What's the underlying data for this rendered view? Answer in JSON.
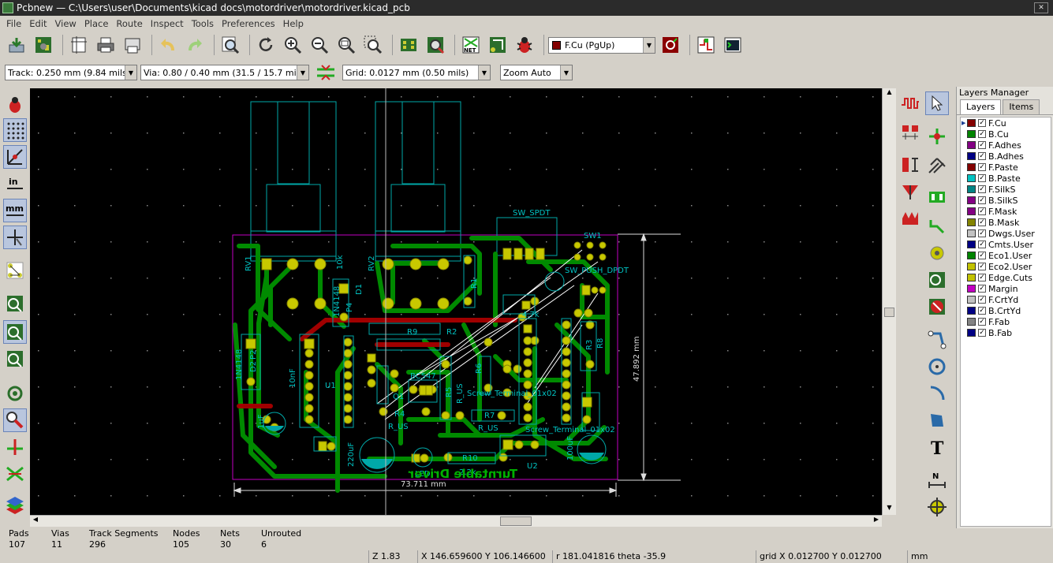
{
  "window": {
    "title": "Pcbnew — C:\\Users\\user\\Documents\\kicad docs\\motordriver\\motordriver.kicad_pcb",
    "close_glyph": "✕"
  },
  "menu": [
    "File",
    "Edit",
    "View",
    "Place",
    "Route",
    "Inspect",
    "Tools",
    "Preferences",
    "Help"
  ],
  "toolbar": {
    "active_layer": "F.Cu (PgUp)",
    "active_layer_color": "#840000",
    "track": "Track: 0.250 mm (9.84 mils) *",
    "via": "Via: 0.80 / 0.40 mm (31.5 / 15.7 mils) *",
    "grid": "Grid: 0.0127 mm (0.50 mils)",
    "zoom": "Zoom Auto"
  },
  "canvas": {
    "silk_labels": {
      "rv1": "RV1",
      "rv2": "RV2",
      "ten_k": "10k",
      "sw_spdt": "SW_SPDT",
      "sw1": "SW1",
      "sw_push_dpdt": "SW_PUSH_DPDT",
      "r1": "R1",
      "r2": "R2",
      "r3": "R3",
      "r4": "R4",
      "r5": "R5",
      "r6": "R6",
      "r7": "R7",
      "r8": "R8",
      "r9": "R9",
      "r10": "R10",
      "u1": "U1",
      "u2": "U2",
      "r_us1": "R_US",
      "r_us2": "R_US",
      "r_us3": "R_US",
      "four_7k": "4.7k",
      "two_2k": "2.2k",
      "bc547": "BC547",
      "screw_term1": "Screw_Terminal_01x02",
      "screw_term2": "Screw_Terminal_01x02",
      "c_220uf": "220uF",
      "c_100uf": "100uF",
      "c_1uf": "1uF",
      "c_10nf": "10nF",
      "led": "LED",
      "n4148_1": "1N4148",
      "n4148_2": "1N4148",
      "d1": "D1",
      "d2": "D2",
      "q1": "Q1",
      "p2": "P2",
      "p4": "P4",
      "turntable": "Turntable Driver",
      "dim_w": "73.711  mm",
      "dim_h": "47.892  mm"
    }
  },
  "layers_panel": {
    "title": "Layers Manager",
    "tabs": [
      "Layers",
      "Items"
    ],
    "check": "✓",
    "items": [
      {
        "name": "F.Cu",
        "color": "#840000"
      },
      {
        "name": "B.Cu",
        "color": "#008400"
      },
      {
        "name": "F.Adhes",
        "color": "#840084"
      },
      {
        "name": "B.Adhes",
        "color": "#000084"
      },
      {
        "name": "F.Paste",
        "color": "#840000"
      },
      {
        "name": "B.Paste",
        "color": "#00c2c2"
      },
      {
        "name": "F.SilkS",
        "color": "#008484"
      },
      {
        "name": "B.SilkS",
        "color": "#840084"
      },
      {
        "name": "F.Mask",
        "color": "#840084"
      },
      {
        "name": "B.Mask",
        "color": "#848400"
      },
      {
        "name": "Dwgs.User",
        "color": "#c2c2c2"
      },
      {
        "name": "Cmts.User",
        "color": "#000084"
      },
      {
        "name": "Eco1.User",
        "color": "#008400"
      },
      {
        "name": "Eco2.User",
        "color": "#c2c200"
      },
      {
        "name": "Edge.Cuts",
        "color": "#c2c200"
      },
      {
        "name": "Margin",
        "color": "#c200c2"
      },
      {
        "name": "F.CrtYd",
        "color": "#c2c2c2"
      },
      {
        "name": "B.CrtYd",
        "color": "#000084"
      },
      {
        "name": "F.Fab",
        "color": "#848484"
      },
      {
        "name": "B.Fab",
        "color": "#000084"
      }
    ]
  },
  "status": {
    "pads_label": "Pads",
    "pads": "107",
    "vias_label": "Vias",
    "vias": "11",
    "tracks_label": "Track Segments",
    "tracks": "296",
    "nodes_label": "Nodes",
    "nodes": "105",
    "nets_label": "Nets",
    "nets": "30",
    "unrouted_label": "Unrouted",
    "unrouted": "6",
    "zoom": "Z 1.83",
    "xy": "X 146.659600  Y 106.146600",
    "polar": "r 181.041816  theta -35.9",
    "grid": "grid X 0.012700  Y 0.012700",
    "units": "mm"
  }
}
